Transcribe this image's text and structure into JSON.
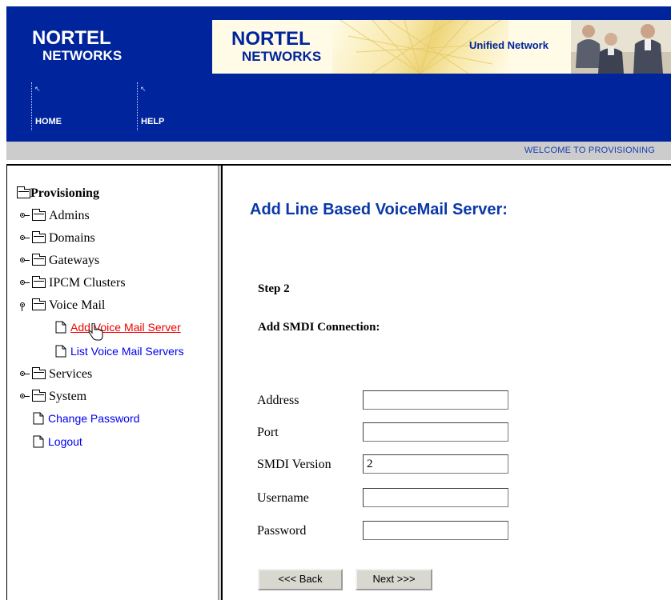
{
  "header": {
    "logo": {
      "line1": "NORTEL",
      "line2": "NETWORKS"
    },
    "banner_logo": {
      "line1": "NORTEL",
      "line2": "NETWORKS"
    },
    "banner_tagline": "Unified Network",
    "nav": [
      {
        "label": "HOME"
      },
      {
        "label": "HELP"
      }
    ],
    "welcome": "WELCOME TO PROVISIONING",
    "colors": {
      "brand_blue": "#00249c",
      "bar_gray": "#cccccc"
    }
  },
  "tree": {
    "root": "Provisioning",
    "items": [
      {
        "label": "Admins"
      },
      {
        "label": "Domains"
      },
      {
        "label": "Gateways"
      },
      {
        "label": "IPCM Clusters"
      },
      {
        "label": "Voice Mail"
      }
    ],
    "voicemail_children": [
      {
        "label": "Add Voice Mail Server"
      },
      {
        "label": "List Voice Mail Servers"
      }
    ],
    "items_after": [
      {
        "label": "Services"
      },
      {
        "label": "System"
      }
    ],
    "links": [
      {
        "label": "Change Password"
      },
      {
        "label": "Logout"
      }
    ]
  },
  "main": {
    "title": "Add Line Based VoiceMail Server:",
    "step": "Step 2",
    "subtitle": "Add SMDI Connection:",
    "fields": [
      {
        "label": "Address",
        "value": ""
      },
      {
        "label": "Port",
        "value": ""
      },
      {
        "label": "SMDI Version",
        "value": "2"
      },
      {
        "label": "Username",
        "value": ""
      },
      {
        "label": "Password",
        "value": ""
      }
    ],
    "back_label": "<<< Back",
    "next_label": "Next >>>"
  }
}
